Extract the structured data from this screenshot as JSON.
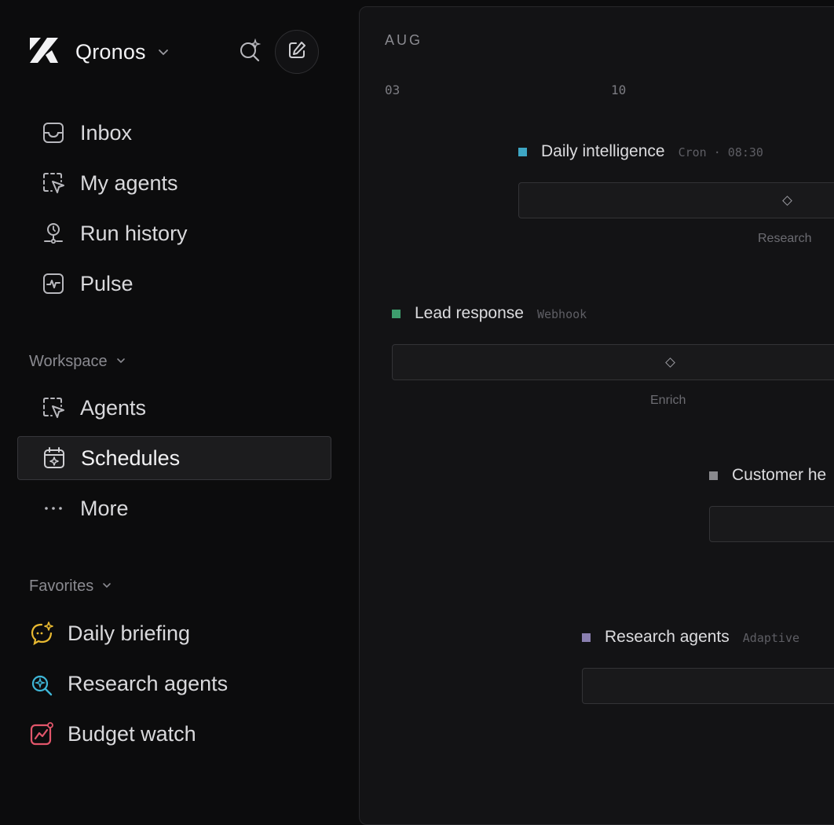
{
  "app": {
    "name": "Qronos"
  },
  "nav": [
    {
      "label": "Inbox",
      "icon": "inbox-icon"
    },
    {
      "label": "My agents",
      "icon": "agent-cursor-icon"
    },
    {
      "label": "Run history",
      "icon": "history-pin-icon"
    },
    {
      "label": "Pulse",
      "icon": "pulse-icon"
    }
  ],
  "workspace": {
    "label": "Workspace",
    "items": [
      {
        "label": "Agents",
        "icon": "agent-cursor-icon"
      },
      {
        "label": "Schedules",
        "icon": "calendar-icon",
        "active": true
      },
      {
        "label": "More",
        "icon": "more-dots-icon"
      }
    ]
  },
  "favorites": {
    "label": "Favorites",
    "items": [
      {
        "label": "Daily briefing",
        "icon": "sparkle-chat-icon",
        "color": "#e8b931"
      },
      {
        "label": "Research agents",
        "icon": "sparkle-search-icon",
        "color": "#3fb7d8"
      },
      {
        "label": "Budget watch",
        "icon": "trend-chart-icon",
        "color": "#e2566b"
      }
    ]
  },
  "timeline": {
    "month": "AUG",
    "ticks": [
      "03",
      "10"
    ],
    "tracks": [
      {
        "name": "Daily intelligence",
        "meta": "Cron · 08:30",
        "color": "#3ea6c4",
        "step": "Research"
      },
      {
        "name": "Lead response",
        "meta": "Webhook",
        "color": "#3e9e6e",
        "step": "Enrich"
      },
      {
        "name": "Customer he",
        "meta": "",
        "color": "#8a8a8e",
        "step": ""
      },
      {
        "name": "Research agents",
        "meta": "Adaptive",
        "color": "#8a7fb0",
        "step": ""
      }
    ]
  }
}
